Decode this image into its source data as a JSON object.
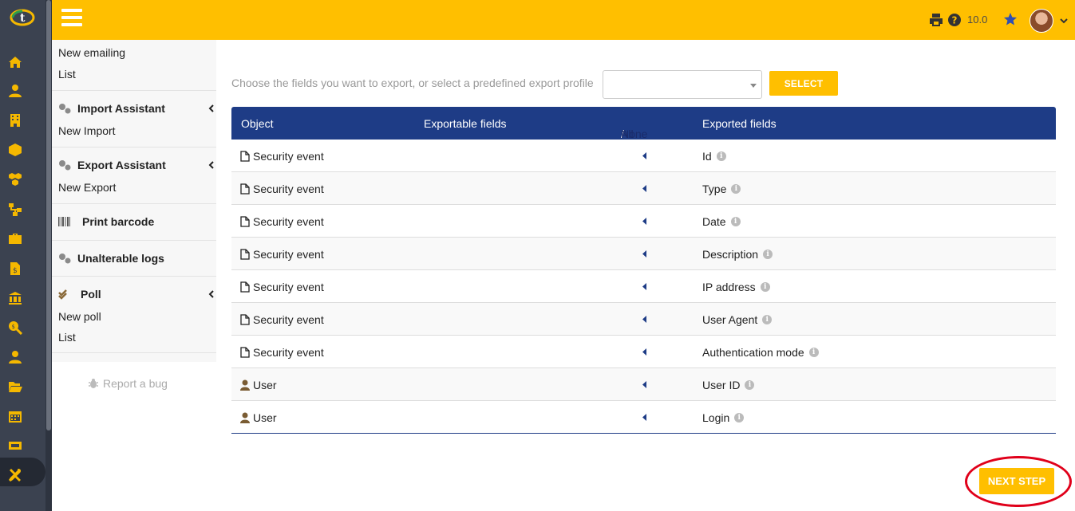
{
  "topbar": {
    "version": "10.0",
    "icons": [
      "print-icon",
      "help-icon",
      "star-icon",
      "avatar",
      "chevron-down-icon"
    ]
  },
  "rail": {
    "icons": [
      "home-icon",
      "user-icon",
      "building-icon",
      "cube-icon",
      "cubes-icon",
      "network-icon",
      "briefcase-icon",
      "invoice-icon",
      "bank-icon",
      "search-dollar-icon",
      "user-tie-icon",
      "folder-open-icon",
      "calendar-icon",
      "ticket-icon",
      "tools-icon"
    ]
  },
  "sidemenu": {
    "top_links": [
      "New emailing",
      "List"
    ],
    "import_assistant": {
      "title": "Import Assistant",
      "link": "New Import"
    },
    "export_assistant": {
      "title": "Export Assistant",
      "link": "New Export"
    },
    "print_barcode": {
      "title": "Print barcode"
    },
    "unalterable_logs": {
      "title": "Unalterable logs"
    },
    "poll": {
      "title": "Poll",
      "links": [
        "New poll",
        "List"
      ]
    },
    "report_bug": "Report a bug"
  },
  "main": {
    "choose_text": "Choose the fields you want to export, or select a predefined export profile",
    "profile_select_value": "",
    "select_button": "SELECT",
    "table": {
      "headers": {
        "object": "Object",
        "exportable": "Exportable fields",
        "all": "All",
        "sep": " / ",
        "none": "None",
        "exported": "Exported fields"
      },
      "rows": [
        {
          "object": "Security event",
          "icon": "file-icon",
          "field": "Id"
        },
        {
          "object": "Security event",
          "icon": "file-icon",
          "field": "Type"
        },
        {
          "object": "Security event",
          "icon": "file-icon",
          "field": "Date"
        },
        {
          "object": "Security event",
          "icon": "file-icon",
          "field": "Description"
        },
        {
          "object": "Security event",
          "icon": "file-icon",
          "field": "IP address"
        },
        {
          "object": "Security event",
          "icon": "file-icon",
          "field": "User Agent"
        },
        {
          "object": "Security event",
          "icon": "file-icon",
          "field": "Authentication mode"
        },
        {
          "object": "User",
          "icon": "user-icon",
          "field": "User ID"
        },
        {
          "object": "User",
          "icon": "user-icon",
          "field": "Login"
        }
      ]
    },
    "next_button": "NEXT STEP"
  },
  "colors": {
    "accent": "#ffbf00",
    "table_header": "#1e3c86",
    "rail": "#3b4250",
    "highlight": "#e0001a"
  }
}
